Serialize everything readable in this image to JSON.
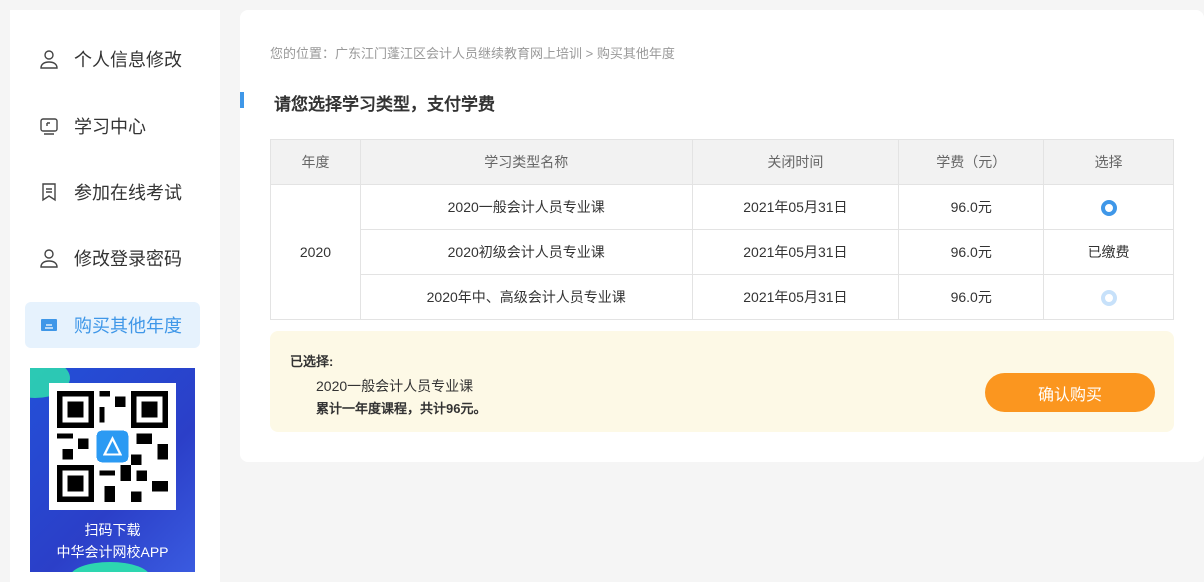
{
  "sidebar": {
    "items": [
      {
        "label": "个人信息修改",
        "icon": "user-icon"
      },
      {
        "label": "学习中心",
        "icon": "monitor-icon"
      },
      {
        "label": "参加在线考试",
        "icon": "exam-icon"
      },
      {
        "label": "修改登录密码",
        "icon": "user-icon"
      },
      {
        "label": "购买其他年度",
        "icon": "calendar-icon",
        "active": true
      }
    ],
    "banner": {
      "line1": "扫码下载",
      "line2": "中华会计网校APP"
    }
  },
  "breadcrumb": "您的位置：广东江门蓬江区会计人员继续教育网上培训 > 购买其他年度",
  "title": "请您选择学习类型，支付学费",
  "table": {
    "headers": [
      "年度",
      "学习类型名称",
      "关闭时间",
      "学费（元）",
      "选择"
    ],
    "year": "2020",
    "rows": [
      {
        "name": "2020一般会计人员专业课",
        "close": "2021年05月31日",
        "fee": "96.0元",
        "select": "selected"
      },
      {
        "name": "2020初级会计人员专业课",
        "close": "2021年05月31日",
        "fee": "96.0元",
        "select": "已缴费"
      },
      {
        "name": "2020年中、高级会计人员专业课",
        "close": "2021年05月31日",
        "fee": "96.0元",
        "select": "unselected"
      }
    ]
  },
  "summary": {
    "label": "已选择:",
    "course": "2020一般会计人员专业课",
    "total": "累计一年度课程，共计96元。",
    "button": "确认购买"
  },
  "colors": {
    "accent": "#3f97e8",
    "button": "#fb961f",
    "summary_bg": "#fdf9e6"
  }
}
